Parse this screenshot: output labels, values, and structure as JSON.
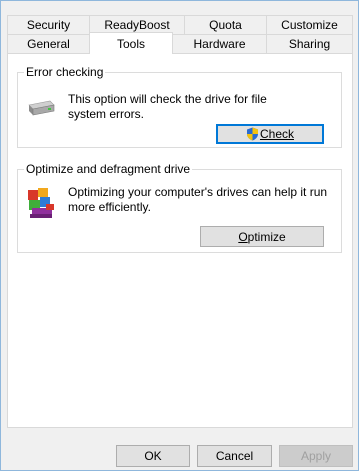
{
  "tabs_row1": [
    "Security",
    "ReadyBoost",
    "Quota",
    "Customize"
  ],
  "tabs_row2": [
    "General",
    "Tools",
    "Hardware",
    "Sharing"
  ],
  "error_checking": {
    "title": "Error checking",
    "description_line1": "This option will check the drive for file",
    "description_line2": "system errors.",
    "button_label": "Check"
  },
  "optimize": {
    "title": "Optimize and defragment drive",
    "description_line1": "Optimizing your computer's drives can help it run",
    "description_line2": "more efficiently.",
    "button_label": "Optimize"
  },
  "footer": {
    "ok_label": "OK",
    "cancel_label": "Cancel",
    "apply_label": "Apply"
  },
  "icons": {
    "drive": "drive-icon",
    "shield": "uac-shield-icon",
    "defrag": "defrag-icon"
  }
}
